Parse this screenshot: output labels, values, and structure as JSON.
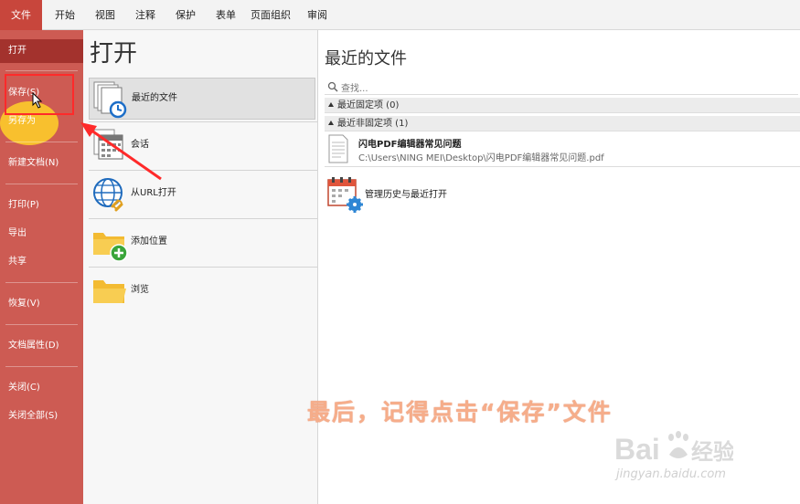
{
  "menubar": {
    "items": [
      "文件",
      "开始",
      "视图",
      "注释",
      "保护",
      "表单",
      "页面组织",
      "审阅"
    ],
    "active": "文件"
  },
  "sidebar": {
    "items": [
      {
        "label": "打开"
      },
      {
        "label": "保存(S)"
      },
      {
        "label": "另存为"
      },
      {
        "label": "新建文档(N)"
      },
      {
        "label": "打印(P)"
      },
      {
        "label": "导出"
      },
      {
        "label": "共享"
      },
      {
        "label": "恢复(V)"
      },
      {
        "label": "文档属性(D)"
      },
      {
        "label": "关闭(C)"
      },
      {
        "label": "关闭全部(S)"
      }
    ],
    "selected": "打开"
  },
  "open_pane": {
    "title": "打开",
    "options": [
      {
        "label": "最近的文件",
        "icon": "recent-files-icon"
      },
      {
        "label": "会话",
        "icon": "session-icon"
      },
      {
        "label": "从URL打开",
        "icon": "url-globe-icon"
      },
      {
        "label": "添加位置",
        "icon": "add-location-icon"
      },
      {
        "label": "浏览",
        "icon": "browse-folder-icon"
      }
    ],
    "selected": "最近的文件"
  },
  "recent": {
    "title": "最近的文件",
    "search_placeholder": "查找...",
    "pinned_header": "最近固定项 (0)",
    "unpinned_header": "最近非固定项 (1)",
    "files": [
      {
        "name": "闪电PDF编辑器常见问题",
        "path": "C:\\Users\\NING MEI\\Desktop\\闪电PDF编辑器常见问题.pdf"
      }
    ],
    "manage_label": "管理历史与最近打开"
  },
  "overlay": {
    "caption": "最后，记得点击“保存”文件",
    "watermark_sub": "jingyan.baidu.com"
  },
  "colors": {
    "sidebar": "#cd5b53",
    "sidebar_selected": "#a3322d",
    "file_tab": "#c8463c",
    "caption": "#f6ad8a",
    "annotation_red": "#ff2a2a"
  }
}
